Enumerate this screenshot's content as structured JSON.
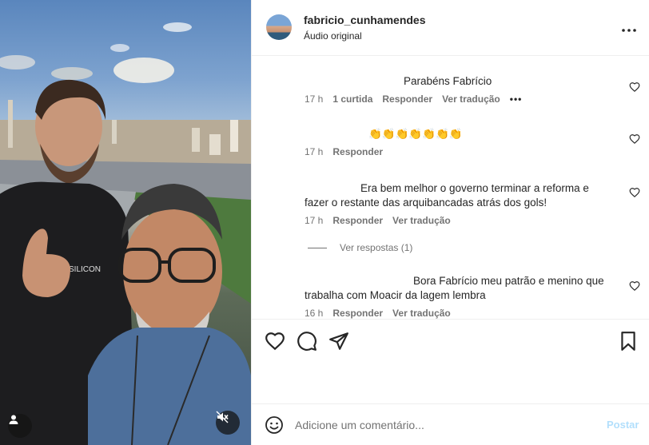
{
  "post": {
    "username": "fabricio_cunhamendes",
    "audio": "Áudio original"
  },
  "comments": [
    {
      "text": "Parabéns Fabrício",
      "time": "17 h",
      "likes": "1 curtida",
      "reply": "Responder",
      "translate": "Ver tradução",
      "more": "•••"
    },
    {
      "text": "👏👏👏👏👏👏👏",
      "time": "17 h",
      "reply": "Responder"
    },
    {
      "text": "Era bem melhor o governo terminar a reforma e fazer o restante das arquibancadas atrás dos gols!",
      "time": "17 h",
      "reply": "Responder",
      "translate": "Ver tradução",
      "view_replies": "Ver respostas (1)"
    },
    {
      "text": "Bora Fabrício meu patrão e menino que trabalha com Moacir da lagem lembra",
      "time": "16 h",
      "reply": "Responder",
      "translate": "Ver tradução"
    }
  ],
  "composer": {
    "placeholder": "Adicione um comentário...",
    "post_label": "Postar"
  },
  "icons": {
    "more": "more-options-icon",
    "like": "heart-icon",
    "comment": "comment-icon",
    "share": "share-icon",
    "save": "bookmark-icon",
    "emoji": "emoji-icon",
    "mute": "muted-speaker-icon",
    "user_tag": "user-tag-icon"
  },
  "colors": {
    "text": "#262626",
    "secondary": "#737373",
    "post_disabled": "#b2dffc",
    "divider": "#efefef"
  }
}
